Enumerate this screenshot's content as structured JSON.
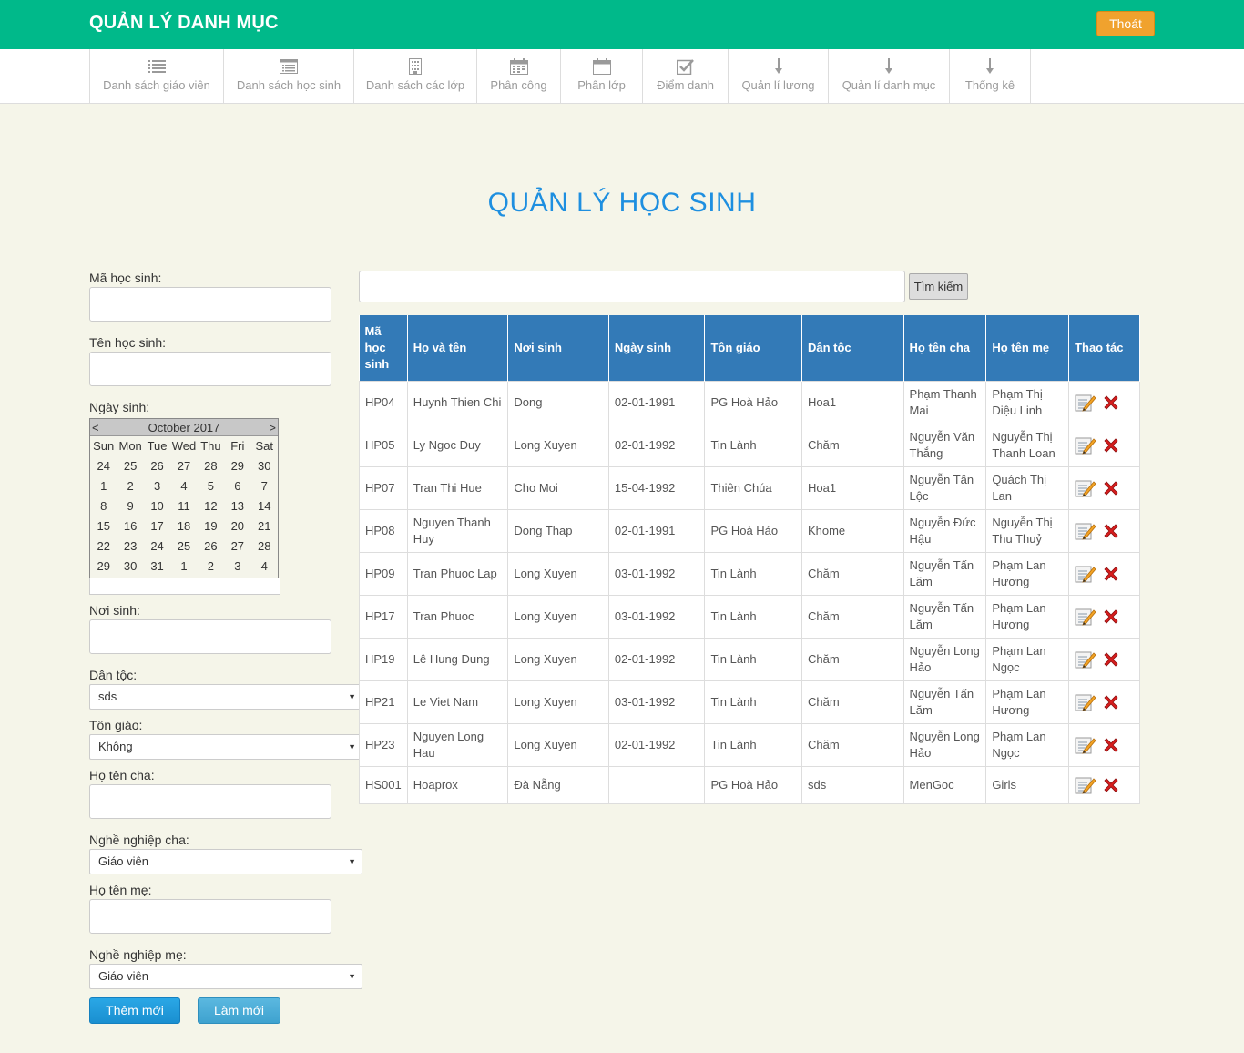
{
  "header": {
    "title": "QUẢN LÝ DANH MỤC",
    "logout_label": "Thoát"
  },
  "nav": [
    {
      "label": "Danh sách giáo viên",
      "icon": "list-icon"
    },
    {
      "label": "Danh sách học sinh",
      "icon": "card-list-icon"
    },
    {
      "label": "Danh sách các lớp",
      "icon": "building-icon"
    },
    {
      "label": "Phân công",
      "icon": "calendar-grid-icon"
    },
    {
      "label": "Phân lớp",
      "icon": "calendar-icon"
    },
    {
      "label": "Điểm danh",
      "icon": "check-square-icon"
    },
    {
      "label": "Quản lí lương",
      "icon": "arrow-down-icon"
    },
    {
      "label": "Quản lí danh mục",
      "icon": "arrow-down-icon"
    },
    {
      "label": "Thống kê",
      "icon": "arrow-down-icon"
    }
  ],
  "page": {
    "title": "QUẢN LÝ HỌC SINH"
  },
  "form": {
    "student_id_label": "Mã học sinh:",
    "student_name_label": "Tên học sinh:",
    "birthdate_label": "Ngày sinh:",
    "birthplace_label": "Nơi sinh:",
    "ethnicity_label": "Dân tộc:",
    "ethnicity_value": "sds",
    "religion_label": "Tôn giáo:",
    "religion_value": "Không",
    "father_name_label": "Họ tên cha:",
    "father_job_label": "Nghề nghiệp cha:",
    "father_job_value": "Giáo viên",
    "mother_name_label": "Họ tên mẹ:",
    "mother_job_label": "Nghề nghiệp mẹ:",
    "mother_job_value": "Giáo viên",
    "add_label": "Thêm mới",
    "reset_label": "Làm mới"
  },
  "calendar": {
    "prev": "<",
    "next": ">",
    "month_label": "October 2017",
    "dows": [
      "Sun",
      "Mon",
      "Tue",
      "Wed",
      "Thu",
      "Fri",
      "Sat"
    ],
    "weeks": [
      [
        "24",
        "25",
        "26",
        "27",
        "28",
        "29",
        "30"
      ],
      [
        "1",
        "2",
        "3",
        "4",
        "5",
        "6",
        "7"
      ],
      [
        "8",
        "9",
        "10",
        "11",
        "12",
        "13",
        "14"
      ],
      [
        "15",
        "16",
        "17",
        "18",
        "19",
        "20",
        "21"
      ],
      [
        "22",
        "23",
        "24",
        "25",
        "26",
        "27",
        "28"
      ],
      [
        "29",
        "30",
        "31",
        "1",
        "2",
        "3",
        "4"
      ]
    ]
  },
  "search": {
    "button_label": "Tìm kiếm"
  },
  "table": {
    "headers": [
      "Mã học sinh",
      "Họ và tên",
      "Nơi sinh",
      "Ngày sinh",
      "Tôn giáo",
      "Dân tộc",
      "Họ tên cha",
      "Họ tên mẹ",
      "Thao tác"
    ],
    "rows": [
      [
        "HP04",
        "Huynh Thien Chi",
        "Dong",
        "02-01-1991",
        "PG Hoà Hảo",
        "Hoa1",
        "Phạm Thanh Mai",
        "Phạm Thị Diệu Linh"
      ],
      [
        "HP05",
        "Ly Ngoc Duy",
        "Long Xuyen",
        "02-01-1992",
        "Tin Lành",
        "Chăm",
        "Nguyễn Văn Thắng",
        "Nguyễn Thị Thanh Loan"
      ],
      [
        "HP07",
        "Tran Thi Hue",
        "Cho Moi",
        "15-04-1992",
        "Thiên Chúa",
        "Hoa1",
        "Nguyễn Tấn Lộc",
        "Quách Thị Lan"
      ],
      [
        "HP08",
        "Nguyen Thanh Huy",
        "Dong Thap",
        "02-01-1991",
        "PG Hoà Hảo",
        "Khome",
        "Nguyễn Đức Hậu",
        "Nguyễn Thị Thu Thuỷ"
      ],
      [
        "HP09",
        "Tran Phuoc Lap",
        "Long Xuyen",
        "03-01-1992",
        "Tin Lành",
        "Chăm",
        "Nguyễn Tấn Lăm",
        "Phạm Lan Hương"
      ],
      [
        "HP17",
        "Tran Phuoc",
        "Long Xuyen",
        "03-01-1992",
        "Tin Lành",
        "Chăm",
        "Nguyễn Tấn Lăm",
        "Phạm Lan Hương"
      ],
      [
        "HP19",
        "Lê Hung Dung",
        "Long Xuyen",
        "02-01-1992",
        "Tin Lành",
        "Chăm",
        "Nguyễn Long Hảo",
        "Phạm Lan Ngọc"
      ],
      [
        "HP21",
        "Le Viet Nam",
        "Long Xuyen",
        "03-01-1992",
        "Tin Lành",
        "Chăm",
        "Nguyễn Tấn Lăm",
        "Phạm Lan Hương"
      ],
      [
        "HP23",
        "Nguyen Long Hau",
        "Long Xuyen",
        "02-01-1992",
        "Tin Lành",
        "Chăm",
        "Nguyễn Long Hảo",
        "Phạm Lan Ngọc"
      ],
      [
        "HS001",
        "Hoaprox",
        "Đà Nẵng",
        "",
        "PG Hoà Hảo",
        "sds",
        "MenGoc",
        "Girls"
      ]
    ]
  },
  "colors": {
    "header_bg": "#00b98a",
    "table_header_bg": "#337ab7",
    "title": "#1e8fe0",
    "logout_bg": "#f0a22e"
  }
}
